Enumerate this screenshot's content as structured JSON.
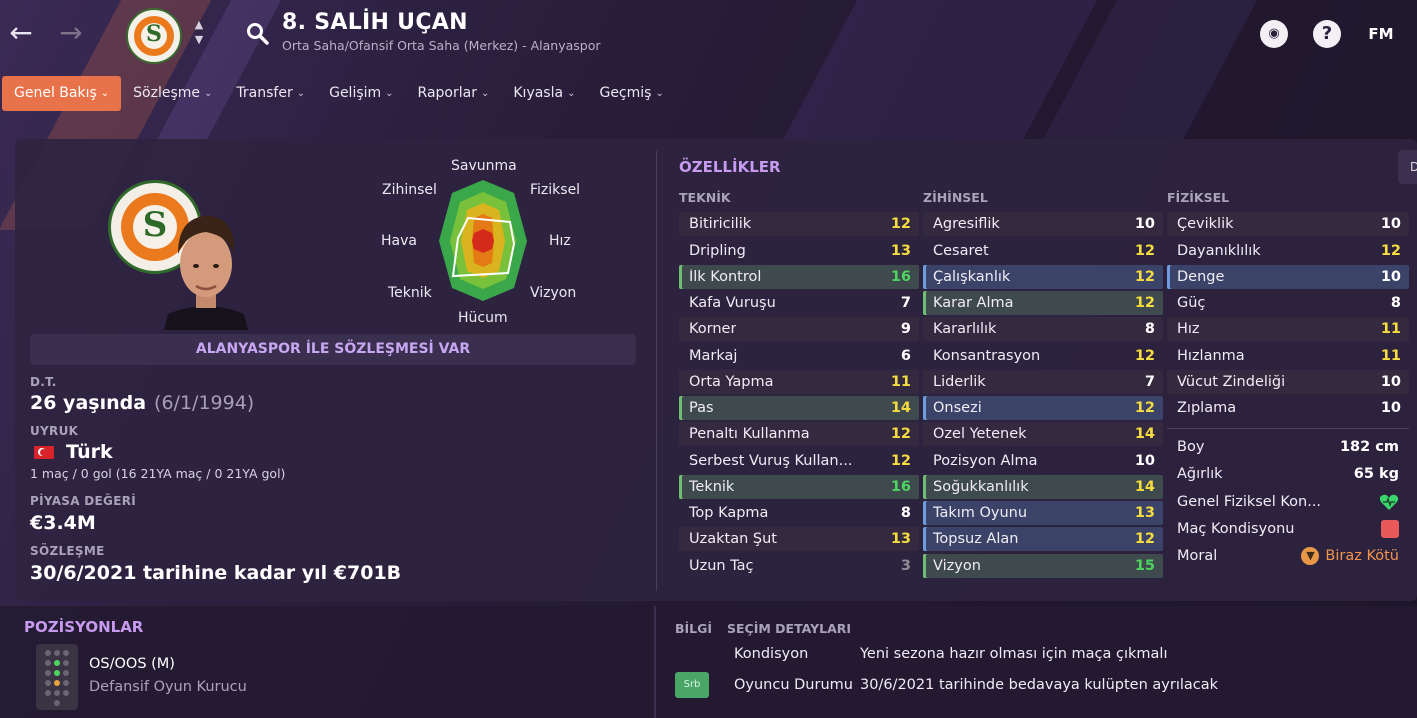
{
  "header": {
    "title": "8. SALİH UÇAN",
    "subtitle": "Orta Saha/Ofansif Orta Saha (Merkez) - Alanyaspor",
    "fm_label": "FM",
    "help_label": "?"
  },
  "tabs": [
    {
      "label": "Genel Bakış"
    },
    {
      "label": "Sözleşme"
    },
    {
      "label": "Transfer"
    },
    {
      "label": "Gelişim"
    },
    {
      "label": "Raporlar"
    },
    {
      "label": "Kıyasla"
    },
    {
      "label": "Geçmiş"
    }
  ],
  "overview": {
    "contract_banner": "ALANYASPOR İLE SÖZLEŞMESİ VAR",
    "dob_label": "D.T.",
    "age": "26 yaşında",
    "dob": "(6/1/1994)",
    "nationality_label": "UYRUK",
    "nationality": "Türk",
    "caps": "1 maç / 0 gol (16 21YA maç / 0 21YA gol)",
    "value_label": "PİYASA DEĞERİ",
    "value": "€3.4M",
    "contract_label": "SÖZLEŞME",
    "contract": "30/6/2021 tarihine kadar yıl €701B"
  },
  "radar": {
    "labels": {
      "top": "Savunma",
      "top_right": "Fiziksel",
      "right": "Hız",
      "bottom_right": "Vizyon",
      "bottom": "Hücum",
      "bottom_left": "Teknik",
      "left": "Hava",
      "top_left": "Zihinsel"
    }
  },
  "attributes": {
    "title": "ÖZELLİKLER",
    "side_tab": "D",
    "technical_header": "TEKNİK",
    "mental_header": "ZİHİNSEL",
    "physical_header": "FİZİKSEL",
    "technical": [
      {
        "name": "Bitiricilik",
        "value": "12"
      },
      {
        "name": "Dripling",
        "value": "13"
      },
      {
        "name": "İlk Kontrol",
        "value": "16"
      },
      {
        "name": "Kafa Vuruşu",
        "value": "7"
      },
      {
        "name": "Korner",
        "value": "9"
      },
      {
        "name": "Markaj",
        "value": "6"
      },
      {
        "name": "Orta Yapma",
        "value": "11"
      },
      {
        "name": "Pas",
        "value": "14"
      },
      {
        "name": "Penaltı Kullanma",
        "value": "12"
      },
      {
        "name": "Serbest Vuruş Kullan...",
        "value": "12"
      },
      {
        "name": "Teknik",
        "value": "16"
      },
      {
        "name": "Top Kapma",
        "value": "8"
      },
      {
        "name": "Uzaktan Şut",
        "value": "13"
      },
      {
        "name": "Uzun Taç",
        "value": "3"
      }
    ],
    "mental": [
      {
        "name": "Agresiflik",
        "value": "10"
      },
      {
        "name": "Cesaret",
        "value": "12"
      },
      {
        "name": "Çalışkanlık",
        "value": "12"
      },
      {
        "name": "Karar Alma",
        "value": "12"
      },
      {
        "name": "Kararlılık",
        "value": "8"
      },
      {
        "name": "Konsantrasyon",
        "value": "12"
      },
      {
        "name": "Liderlik",
        "value": "7"
      },
      {
        "name": "Önsezi",
        "value": "12"
      },
      {
        "name": "Özel Yetenek",
        "value": "14"
      },
      {
        "name": "Pozisyon Alma",
        "value": "10"
      },
      {
        "name": "Soğukkanlılık",
        "value": "14"
      },
      {
        "name": "Takım Oyunu",
        "value": "13"
      },
      {
        "name": "Topsuz Alan",
        "value": "12"
      },
      {
        "name": "Vizyon",
        "value": "15"
      }
    ],
    "physical": [
      {
        "name": "Çeviklik",
        "value": "10"
      },
      {
        "name": "Dayanıklılık",
        "value": "12"
      },
      {
        "name": "Denge",
        "value": "10"
      },
      {
        "name": "Güç",
        "value": "8"
      },
      {
        "name": "Hız",
        "value": "11"
      },
      {
        "name": "Hızlanma",
        "value": "11"
      },
      {
        "name": "Vücut Zindeliği",
        "value": "10"
      },
      {
        "name": "Zıplama",
        "value": "10"
      }
    ],
    "extra": {
      "height_label": "Boy",
      "height": "182 cm",
      "weight_label": "Ağırlık",
      "weight": "65 kg",
      "fitness_label": "Genel Fiziksel Kon...",
      "condition_label": "Maç Kondisyonu",
      "morale_label": "Moral",
      "morale": "Biraz Kötü"
    }
  },
  "positions": {
    "title": "POZİSYONLAR",
    "main": "OS/OOS (M)",
    "role": "Defansif Oyun Kurucu"
  },
  "info": {
    "info_header": "BİLGİ",
    "selection_header": "SEÇİM DETAYLARI",
    "badge": "Srb",
    "rows": [
      {
        "key": "Kondisyon",
        "value": "Yeni sezona hazır olması için maça çıkmalı"
      },
      {
        "key": "Oyuncu Durumu",
        "value": "30/6/2021 tarihinde bedavaya kulüpten ayrılacak"
      }
    ]
  },
  "colors": {
    "accent": "#e8724a",
    "section_title": "#c79af0",
    "value_yellow": "#f5dc3f",
    "value_green": "#4cd660",
    "morale": "#f1944c"
  }
}
